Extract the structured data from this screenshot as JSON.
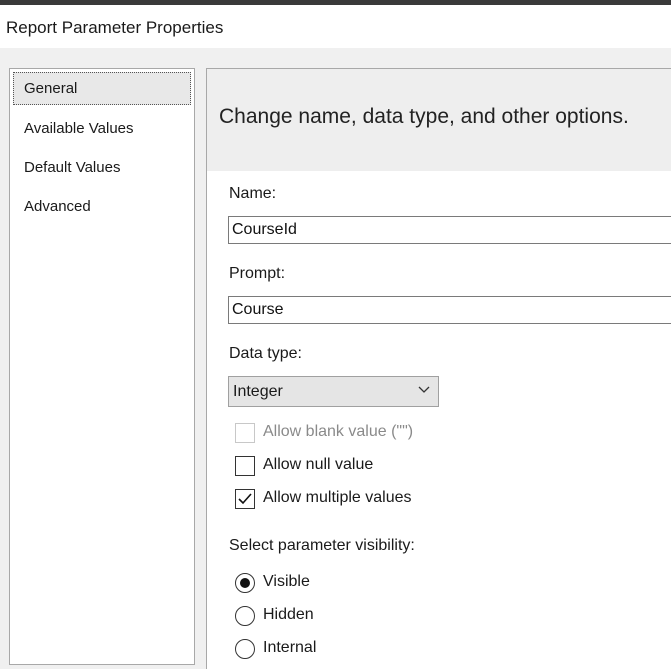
{
  "window": {
    "title": "Report Parameter Properties"
  },
  "nav": {
    "items": [
      {
        "label": "General",
        "selected": true
      },
      {
        "label": "Available Values",
        "selected": false
      },
      {
        "label": "Default Values",
        "selected": false
      },
      {
        "label": "Advanced",
        "selected": false
      }
    ]
  },
  "banner": {
    "text": "Change name, data type, and other options."
  },
  "form": {
    "name_label": "Name:",
    "name_value": "CourseId",
    "prompt_label": "Prompt:",
    "prompt_value": "Course",
    "datatype_label": "Data type:",
    "datatype_value": "Integer",
    "checkboxes": [
      {
        "label": "Allow blank value (\"\")",
        "checked": false,
        "enabled": false
      },
      {
        "label": "Allow null value",
        "checked": false,
        "enabled": true
      },
      {
        "label": "Allow multiple values",
        "checked": true,
        "enabled": true
      }
    ],
    "visibility_label": "Select parameter visibility:",
    "visibility_options": [
      {
        "label": "Visible",
        "selected": true
      },
      {
        "label": "Hidden",
        "selected": false
      },
      {
        "label": "Internal",
        "selected": false
      }
    ]
  }
}
